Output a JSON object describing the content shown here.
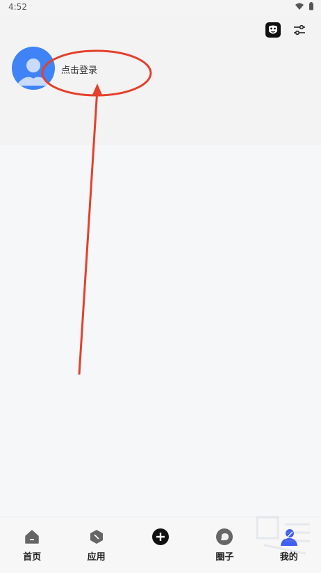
{
  "status_bar": {
    "time": "4:52"
  },
  "profile": {
    "login_prompt": "点击登录"
  },
  "tabs": [
    {
      "label": "首页"
    },
    {
      "label": "应用"
    },
    {
      "label": ""
    },
    {
      "label": "圈子"
    },
    {
      "label": "我的"
    }
  ],
  "colors": {
    "accent": "#3f83f6",
    "annotation": "#e5402b"
  }
}
